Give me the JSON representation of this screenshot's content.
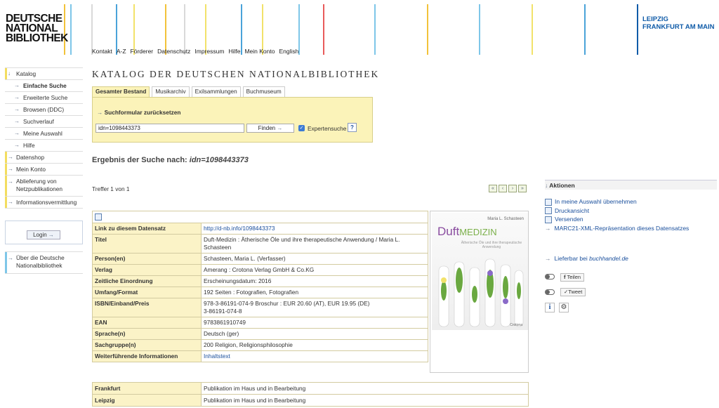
{
  "header": {
    "logo_lines": [
      "DEUTSCHE",
      "NATIONAL",
      "BIBLIOTHEK"
    ],
    "cities": [
      "LEIPZIG",
      "FRANKFURT AM MAIN"
    ],
    "nav": [
      "Kontakt",
      "A-Z",
      "Förderer",
      "Datenschutz",
      "Impressum",
      "Hilfe",
      "Mein Konto",
      "English"
    ]
  },
  "sidebar": {
    "items": [
      "Katalog",
      "Einfache Suche",
      "Erweiterte Suche",
      "Browsen (DDC)",
      "Suchverlauf",
      "Meine Auswahl",
      "Hilfe",
      "Datenshop",
      "Mein Konto",
      "Ablieferung von",
      "Netzpublikationen",
      "Informationsvermittlung"
    ],
    "login_label": "Login",
    "about": [
      "Über die Deutsche",
      "Nationalbibliothek"
    ]
  },
  "main": {
    "title": "KATALOG DER DEUTSCHEN NATIONALBIBLIOTHEK",
    "tabs": [
      "Gesamter Bestand",
      "Musikarchiv",
      "Exilsammlungen",
      "Buchmuseum"
    ],
    "reset_label": "Suchformular zurücksetzen",
    "search_value": "idn=1098443373",
    "find_label": "Finden",
    "expert_label": "Expertensuche",
    "help_label": "?",
    "result_prefix": "Ergebnis der Suche nach:",
    "result_query": "idn=1098443373",
    "hits": "Treffer 1 von 1",
    "pager": [
      "«",
      "‹",
      "›",
      "»"
    ]
  },
  "record": {
    "rows": [
      {
        "k": "Link zu diesem Datensatz",
        "v": "http://d-nb.info/1098443373",
        "link": true
      },
      {
        "k": "Titel",
        "v": "Duft-Medizin : Ätherische Öle und ihre therapeutische Anwendung / Maria L. Schasteen"
      },
      {
        "k": "Person(en)",
        "v": "Schasteen, Maria L. (Verfasser)"
      },
      {
        "k": "Verlag",
        "v": "Amerang : Crotona Verlag GmbH & Co.KG"
      },
      {
        "k": "Zeitliche Einordnung",
        "v": "Erscheinungsdatum: 2016"
      },
      {
        "k": "Umfang/Format",
        "v": "192 Seiten : Fotografien, Fotografien"
      },
      {
        "k": "ISBN/Einband/Preis",
        "v": "978-3-86191-074-9 Broschur : EUR 20.60 (AT), EUR 19.95 (DE)",
        "v2": "3-86191-074-8"
      },
      {
        "k": "EAN",
        "v": "9783861910749"
      },
      {
        "k": "Sprache(n)",
        "v": "Deutsch (ger)"
      },
      {
        "k": "Sachgruppe(n)",
        "v": "200 Religion, Religionsphilosophie"
      },
      {
        "k": "Weiterführende Informationen",
        "v": "Inhaltstext",
        "link": true
      }
    ],
    "cover": {
      "author": "Maria L. Schasteen",
      "title_a": "Duft",
      "title_b": "MEDIZIN",
      "subtitle": "Ätherische Öle und ihre therapeutische Anwendung",
      "publisher": "Crotona"
    },
    "locations": [
      {
        "k": "Frankfurt",
        "v": "Publikation im Haus und in Bearbeitung"
      },
      {
        "k": "Leipzig",
        "v": "Publikation im Haus und in Bearbeitung"
      }
    ]
  },
  "aside": {
    "heading": "Aktionen",
    "actions": [
      "In meine Auswahl übernehmen",
      "Druckansicht",
      "Versenden",
      "MARC21-XML-Repräsentation dieses Datensatzes"
    ],
    "buy_prefix": "Lieferbar bei",
    "buy_shop": "buchhandel.de",
    "share": "Teilen",
    "tweet": "Tweet",
    "info": "i",
    "gear": "⚙"
  },
  "colors": {
    "yellow": "#fbf3b9",
    "blue": "#0f5ba8",
    "lines": [
      "#d6c63a",
      "#f2c23a",
      "#4aa3d9",
      "#e85b5b",
      "#7ec6e8"
    ]
  }
}
